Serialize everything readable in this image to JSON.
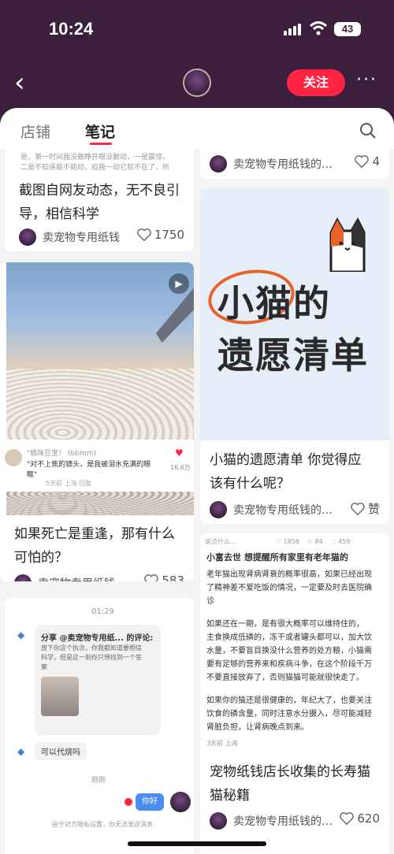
{
  "status": {
    "time": "10:24",
    "battery": "43"
  },
  "header": {
    "follow_label": "关注",
    "more_label": "···"
  },
  "tabs": [
    {
      "label": "店铺"
    },
    {
      "label": "笔记"
    }
  ],
  "author_name": "卖宠物专用纸钱的…",
  "cards": {
    "c1": {
      "clip_line1": "是，第一时间我没敢睁开眼没敢动，一是震惊，",
      "clip_line2": "二是不知道能不能动，掐我一动它就不在了，所",
      "title_line1": "截图自网友动态，无不良引",
      "title_line2": "导，相信科学",
      "author": "卖宠物专用纸钱",
      "likes": "1750"
    },
    "c2": {
      "top_author": "卖宠物专用纸钱的…",
      "top_likes": "4"
    },
    "c3": {
      "comment_user": "\"橘味豆宝！ (bbmm)",
      "comment_text": "\"对不上焦的镜头，是我被泪水充满的眼眶\"",
      "comment_meta": "5天前 上海 回复",
      "comment_likes": "16.6万",
      "title_line1": "如果死亡是重逢，那有什么",
      "title_line2": "可怕的？",
      "author": "卖宠物专用纸钱…",
      "likes": "583"
    },
    "c4": {
      "img_line1": "小猫的",
      "img_line2": "遗愿清单",
      "title_line1": "小猫的遗愿清单 你觉得应",
      "title_line2": "该有什么呢？",
      "author": "卖宠物专用纸钱的…",
      "likes": "赞"
    },
    "c5": {
      "chat_time": "01:29",
      "share_title": "分享 @卖宠物专用纸... 的评论:",
      "share_text1": "放下你这个执念，你我都知道要相信",
      "share_text2": "科学，但是这一刻你只想找到一个答",
      "share_text3": "案",
      "reply": "可以代烧吗",
      "just_now": "刚刚",
      "me_msg": "你好",
      "footer": "由于对方隐私设置，你无法发送消息"
    },
    "c6": {
      "top_user": "说点什么...",
      "stat1": "1858",
      "stat2": "84",
      "stat3": "459",
      "heading": "小富去世 想提醒所有家里有老年猫的",
      "p1_1": "老年猫出现肾病肾衰的概率很高，如果已经出现",
      "p1_2": "了精神差不爱吃饭的情况，一定要及时去医院确",
      "p1_3": "诊",
      "p2_1": "如果还在一期，是有很大概率可以维持住的，",
      "p2_2": "主食换成低磷的，冻干或者罐头都可以，加大饮",
      "p2_3": "水量，不要盲目换没什么营养的处方粮，小猫需",
      "p2_4": "要有足够的营养来和疾病斗争，在这个阶段千万",
      "p2_5": "不要直接放弃了，否则猫猫可能就很快走了。",
      "p3_1": "如果你的猫还是很健康的，年纪大了，也要关注",
      "p3_2": "饮食的磷含量，同时注意水分摄入，尽可能减轻",
      "p3_3": "肾脏负担，让肾病晚点到来。",
      "meta": "3天前 上海",
      "title_line1": "宠物纸钱店长收集的长寿猫",
      "title_line2": "猫秘籍",
      "author": "卖宠物专用纸钱的…",
      "likes": "620"
    }
  }
}
